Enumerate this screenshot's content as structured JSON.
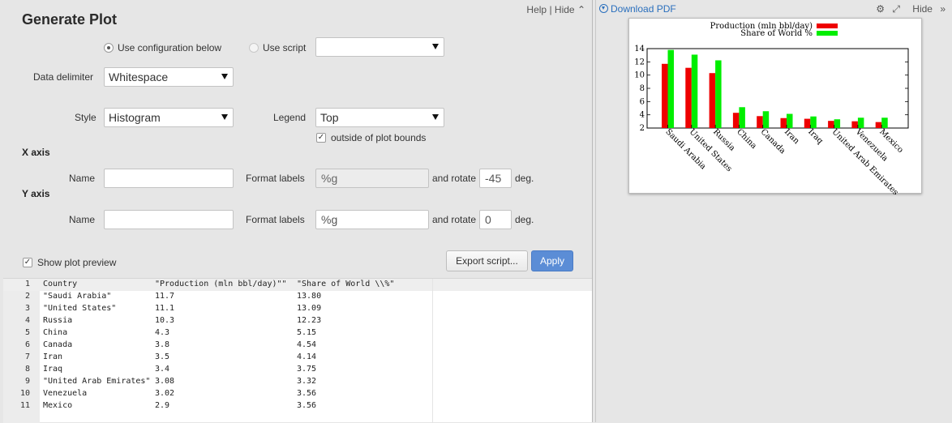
{
  "panel": {
    "title": "Generate Plot",
    "help": "Help",
    "sep": "|",
    "hide": "Hide",
    "hide_icon": "double-chevron-up"
  },
  "config": {
    "use_config_label": "Use configuration below",
    "use_script_label": "Use script",
    "script_value": "",
    "delimiter_label": "Data delimiter",
    "delimiter_value": "Whitespace",
    "style_label": "Style",
    "style_value": "Histogram",
    "legend_label": "Legend",
    "legend_value": "Top",
    "outside_label": "outside of plot bounds",
    "outside_checked": true
  },
  "x_axis": {
    "heading": "X axis",
    "name_label": "Name",
    "name_value": "",
    "format_label": "Format labels",
    "format_value": "%g",
    "rotate_label": "and rotate",
    "rotate_value": "-45",
    "deg_label": "deg."
  },
  "y_axis": {
    "heading": "Y axis",
    "name_label": "Name",
    "name_value": "",
    "format_label": "Format labels",
    "format_value": "%g",
    "rotate_label": "and rotate",
    "rotate_value": "0",
    "deg_label": "deg."
  },
  "preview": {
    "show_label": "Show plot preview",
    "checked": true,
    "export_label": "Export script...",
    "apply_label": "Apply"
  },
  "editor": {
    "lines": [
      {
        "n": "1",
        "c1": "Country",
        "c2": "\"Production (mln bbl/day)\"\"",
        "c3": "\"Share of World \\\\%\""
      },
      {
        "n": "2",
        "c1": "\"Saudi Arabia\"",
        "c2": "11.7",
        "c3": "13.80"
      },
      {
        "n": "3",
        "c1": "\"United States\"",
        "c2": "11.1",
        "c3": "13.09"
      },
      {
        "n": "4",
        "c1": "Russia",
        "c2": "10.3",
        "c3": "12.23"
      },
      {
        "n": "5",
        "c1": "China",
        "c2": "4.3",
        "c3": "5.15"
      },
      {
        "n": "6",
        "c1": "Canada",
        "c2": "3.8",
        "c3": "4.54"
      },
      {
        "n": "7",
        "c1": "Iran",
        "c2": "3.5",
        "c3": "4.14"
      },
      {
        "n": "8",
        "c1": "Iraq",
        "c2": "3.4",
        "c3": "3.75"
      },
      {
        "n": "9",
        "c1": "\"United Arab Emirates\"",
        "c2": "3.08",
        "c3": "3.32"
      },
      {
        "n": "10",
        "c1": "Venezuela",
        "c2": "3.02",
        "c3": "3.56"
      },
      {
        "n": "11",
        "c1": "Mexico",
        "c2": "2.9",
        "c3": "3.56"
      }
    ]
  },
  "right": {
    "download_label": "Download PDF",
    "download_icon": "circle-arrow-down-icon",
    "gear_icon": "gear-icon",
    "expand_icon": "expand-icon",
    "hide_label": "Hide",
    "hide_icon": "double-chevron-right"
  },
  "chart_data": {
    "type": "bar",
    "categories": [
      "Saudi Arabia",
      "United States",
      "Russia",
      "China",
      "Canada",
      "Iran",
      "Iraq",
      "United Arab Emirates",
      "Venezuela",
      "Mexico"
    ],
    "series": [
      {
        "name": "Production (mln bbl/day)",
        "color": "#ee0000",
        "values": [
          11.7,
          11.1,
          10.3,
          4.3,
          3.8,
          3.5,
          3.4,
          3.08,
          3.02,
          2.9
        ]
      },
      {
        "name": "Share of World %",
        "color": "#00ee00",
        "values": [
          13.8,
          13.09,
          12.23,
          5.15,
          4.54,
          4.14,
          3.75,
          3.32,
          3.56,
          3.56
        ]
      }
    ],
    "yticks": [
      "2",
      "4",
      "6",
      "8",
      "10",
      "12",
      "14"
    ],
    "ylim": [
      2,
      14
    ],
    "xtick_rotation": -45,
    "legend_position": "top, outside"
  }
}
